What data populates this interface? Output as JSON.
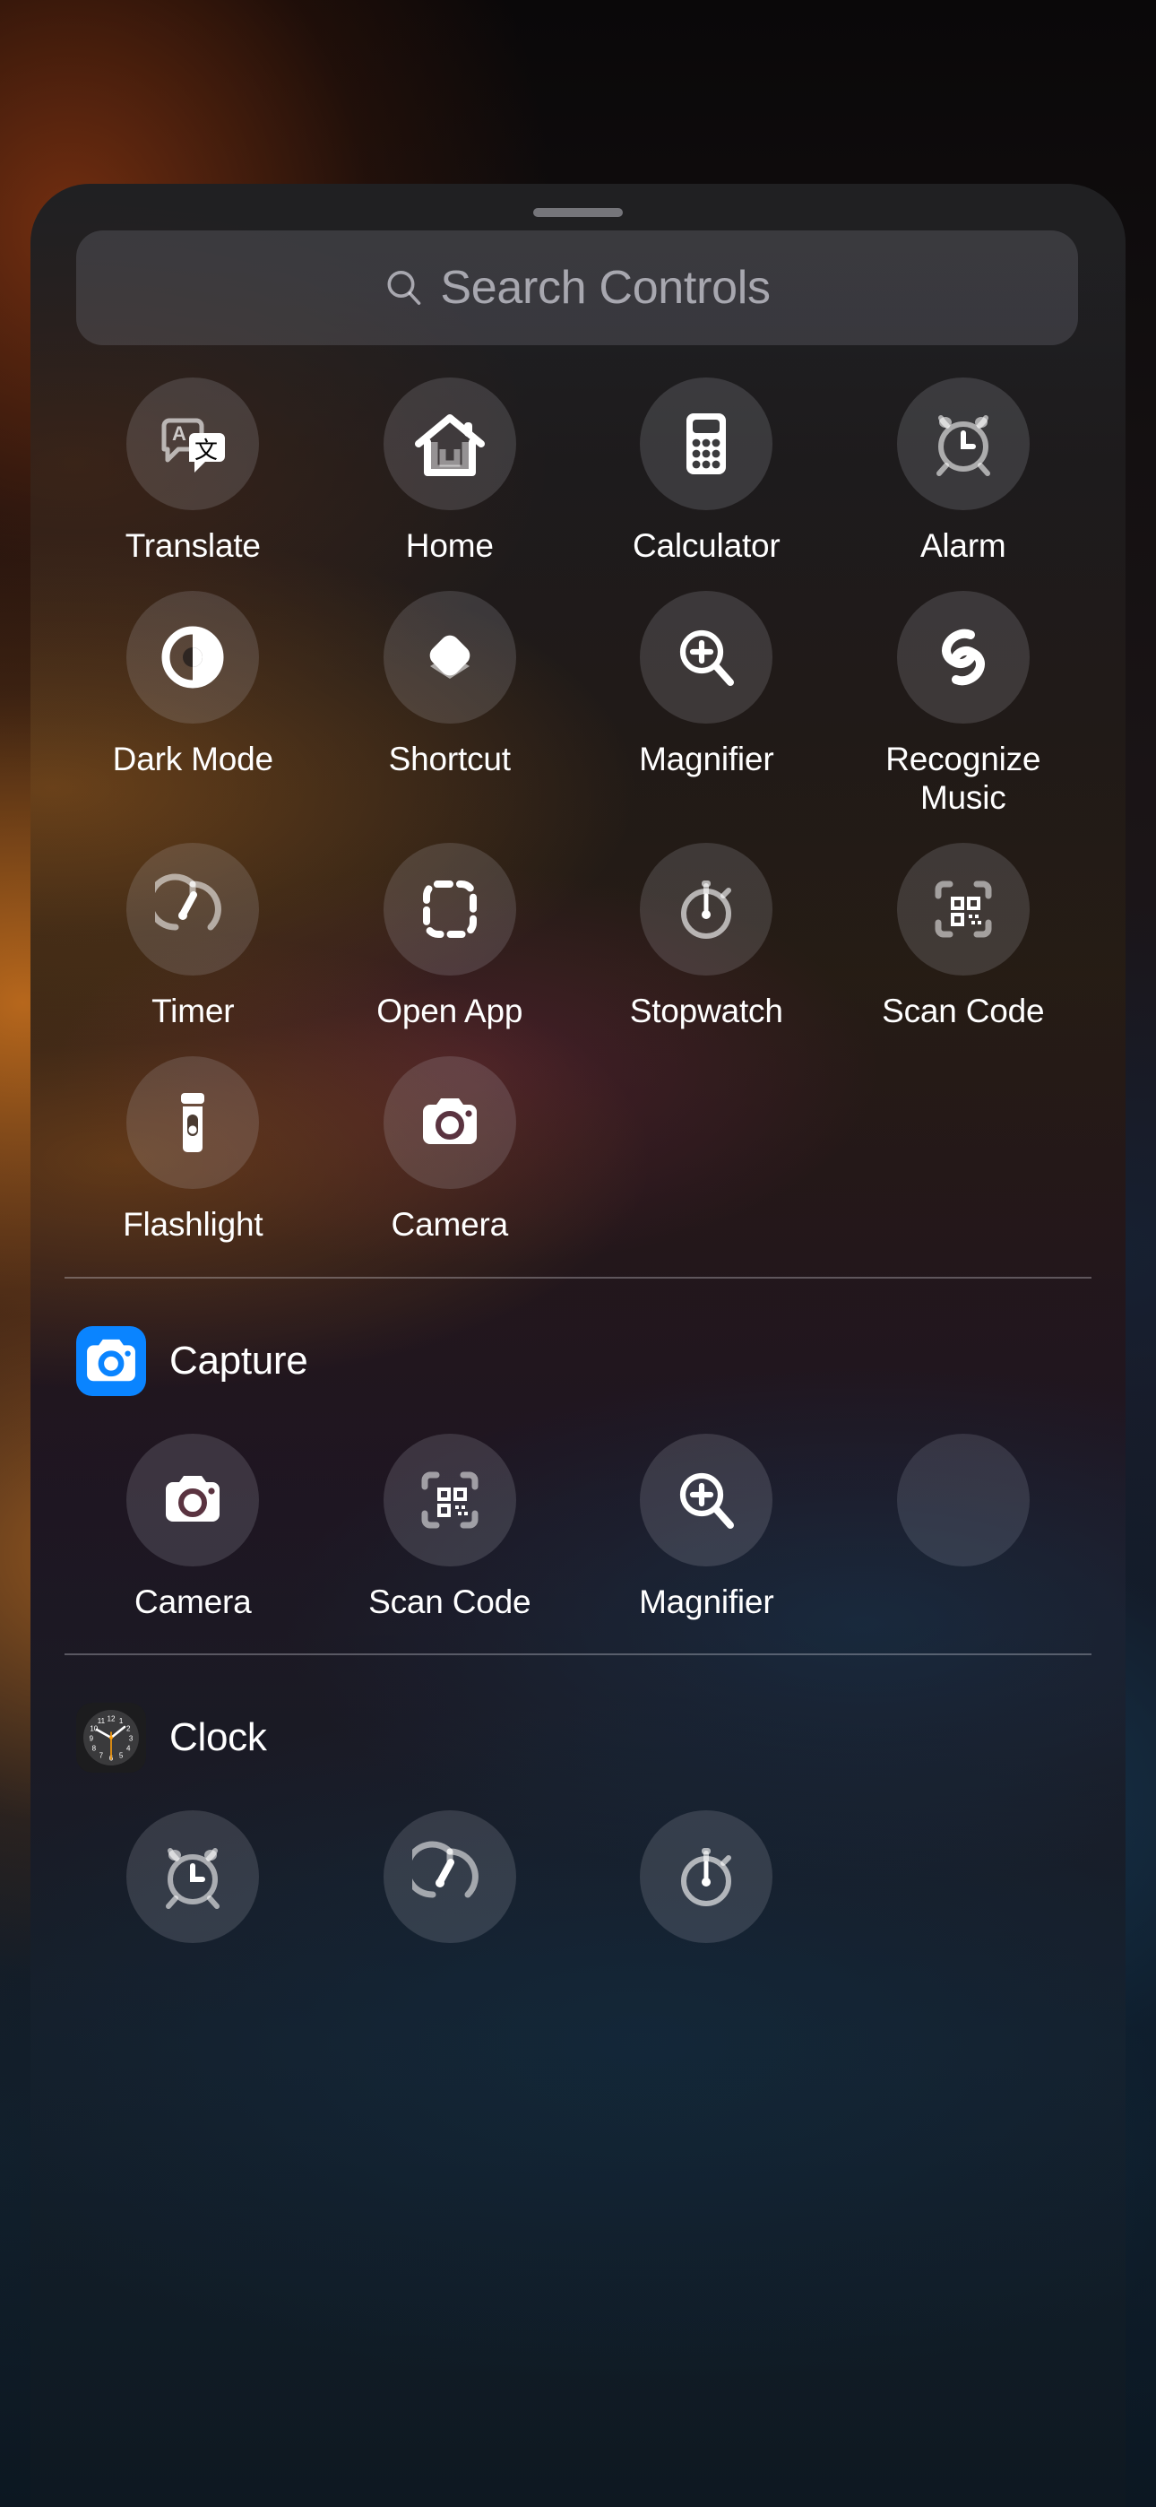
{
  "search": {
    "placeholder": "Search Controls",
    "icon": "search-icon"
  },
  "colors": {
    "accent_capture": "#0A84FF",
    "bubble_fill": "rgba(200,200,210,0.175)",
    "label_text": "#FFFFFF",
    "placeholder_text": "rgba(235,235,245,0.62)",
    "divider": "rgba(235,235,245,0.30)"
  },
  "suggested": {
    "controls": [
      {
        "label": "Translate",
        "icon": "translate-icon"
      },
      {
        "label": "Home",
        "icon": "home-icon"
      },
      {
        "label": "Calculator",
        "icon": "calculator-icon"
      },
      {
        "label": "Alarm",
        "icon": "alarm-icon"
      },
      {
        "label": "Dark Mode",
        "icon": "dark-mode-icon"
      },
      {
        "label": "Shortcut",
        "icon": "shortcut-icon"
      },
      {
        "label": "Magnifier",
        "icon": "magnifier-icon"
      },
      {
        "label": "Recognize Music",
        "icon": "shazam-icon"
      },
      {
        "label": "Timer",
        "icon": "timer-icon"
      },
      {
        "label": "Open App",
        "icon": "open-app-icon"
      },
      {
        "label": "Stopwatch",
        "icon": "stopwatch-icon"
      },
      {
        "label": "Scan Code",
        "icon": "scan-code-icon"
      },
      {
        "label": "Flashlight",
        "icon": "flashlight-icon"
      },
      {
        "label": "Camera",
        "icon": "camera-icon"
      }
    ]
  },
  "sections": [
    {
      "title": "Capture",
      "app_icon": "camera-app-icon",
      "app_icon_color": "#0A84FF",
      "controls": [
        {
          "label": "Camera",
          "icon": "camera-icon"
        },
        {
          "label": "Scan Code",
          "icon": "scan-code-icon"
        },
        {
          "label": "Magnifier",
          "icon": "magnifier-icon"
        },
        {
          "label": "",
          "icon": ""
        }
      ]
    },
    {
      "title": "Clock",
      "app_icon": "clock-app-icon",
      "clock_numerals": [
        "12",
        "1",
        "2",
        "3",
        "4",
        "5",
        "6",
        "7",
        "8",
        "9",
        "10",
        "11"
      ],
      "controls": [
        {
          "label": "",
          "icon": "alarm-icon"
        },
        {
          "label": "",
          "icon": "timer-icon"
        },
        {
          "label": "",
          "icon": "stopwatch-icon"
        }
      ]
    }
  ]
}
